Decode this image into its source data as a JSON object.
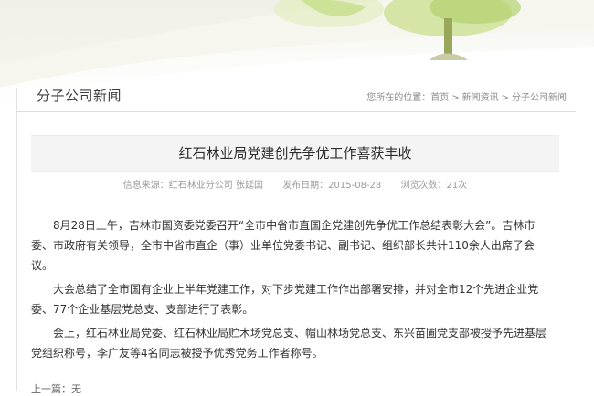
{
  "section": {
    "title": "分子公司新闻"
  },
  "breadcrumb": {
    "prefix": "您所在的位置：",
    "items": [
      "首页",
      "新闻资讯",
      "分子公司新闻"
    ],
    "separator": ">"
  },
  "article": {
    "title": "红石林业局党建创先争优工作喜获丰收",
    "meta": {
      "source": "信息来源：红石林业分公司 张延国",
      "date": "发布日期：2015-08-28",
      "views": "浏览次数：21次"
    },
    "paragraphs": [
      "8月28日上午，吉林市国资委党委召开“全市中省市直国企党建创先争优工作总结表彰大会”。吉林市委、市政府有关领导，全市中省市直企（事）业单位党委书记、副书记、组织部长共计110余人出席了会议。",
      "大会总结了全市国有企业上半年党建工作，对下步党建工作作出部署安排，并对全市12个先进企业党委、77个企业基层党总支、支部进行了表彰。",
      "会上，红石林业局党委、红石林业局贮木场党总支、帽山林场党总支、东兴苗圃党支部被授予先进基层党组织称号，李广友等4名同志被授予优秀党务工作者称号。"
    ]
  },
  "nav": {
    "prev_label": "上一篇：",
    "prev_value": "无"
  },
  "colors": {
    "banner_leaf": "#b9d47a",
    "tree": "#8b9a4a",
    "section_border": "#dedede"
  }
}
